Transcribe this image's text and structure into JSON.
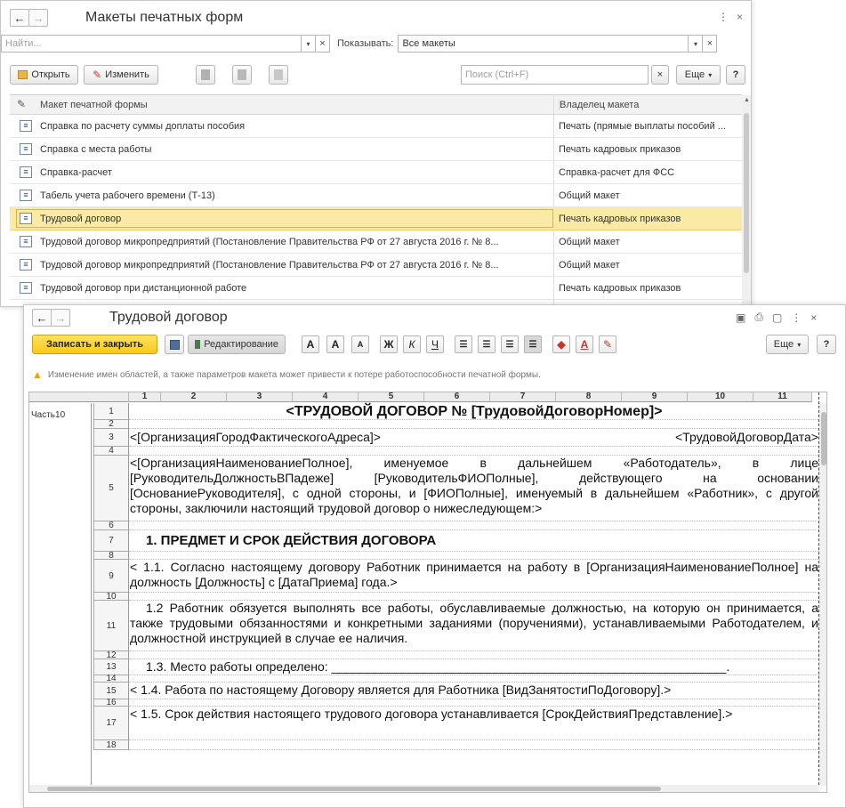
{
  "list": {
    "title": "Макеты печатных форм",
    "find_placeholder": "Найти...",
    "show_label": "Показывать:",
    "show_value": "Все макеты",
    "open_label": "Открыть",
    "edit_label": "Изменить",
    "search_placeholder": "Поиск (Ctrl+F)",
    "more_label": "Еще",
    "help_label": "?",
    "col1": "Макет печатной формы",
    "col2": "Владелец макета",
    "rows": [
      {
        "name": "Справка по расчету суммы доплаты пособия",
        "owner": "Печать (прямые выплаты пособий ..."
      },
      {
        "name": "Справка с места работы",
        "owner": "Печать кадровых приказов"
      },
      {
        "name": "Справка-расчет",
        "owner": "Справка-расчет для ФСС"
      },
      {
        "name": "Табель учета рабочего времени (Т-13)",
        "owner": "Общий макет"
      },
      {
        "name": "Трудовой договор",
        "owner": "Печать кадровых приказов",
        "selected": true
      },
      {
        "name": "Трудовой договор микропредприятий (Постановление Правительства РФ от 27 августа 2016 г. № 8...",
        "owner": "Общий макет"
      },
      {
        "name": "Трудовой договор микропредприятий (Постановление Правительства РФ от 27 августа 2016 г. № 8...",
        "owner": "Общий макет"
      },
      {
        "name": "Трудовой договор при дистанционной работе",
        "owner": "Печать кадровых приказов"
      }
    ]
  },
  "editor": {
    "title": "Трудовой договор",
    "save_close": "Записать и закрыть",
    "editing": "Редактирование",
    "more_label": "Еще",
    "help_label": "?",
    "warning": "Изменение имен областей, а также параметров макета может привести к потере работоспособности печатной формы.",
    "area_name": "Часть10",
    "columns": [
      "1",
      "2",
      "3",
      "4",
      "5",
      "6",
      "7",
      "8",
      "9",
      "10",
      "11"
    ],
    "fmt": {
      "a_big": "A",
      "a_up": "A",
      "a_down": "A",
      "bold": "Ж",
      "italic": "К",
      "underline": "Ч",
      "fill_a": "A"
    },
    "rows": [
      {
        "n": "1",
        "text": "<ТРУДОВОЙ ДОГОВОР № [ТрудовойДоговорНомер]>"
      },
      {
        "n": "2",
        "text": ""
      },
      {
        "n": "3",
        "left": "<[ОрганизацияГородФактическогоАдреса]>",
        "right": "<ТрудовойДоговорДата>"
      },
      {
        "n": "4",
        "text": ""
      },
      {
        "n": "5",
        "text": "<[ОрганизацияНаименованиеПолное], именуемое в дальнейшем «Работодатель», в лице [РуководительДолжностьВПадеже] [РуководительФИОПолные], действующего на основании [ОснованиеРуководителя], с одной стороны, и [ФИОПолные], именуемый в дальнейшем «Работник», с другой стороны, заключили настоящий трудовой договор о нижеследующем:>"
      },
      {
        "n": "6",
        "text": ""
      },
      {
        "n": "7",
        "text": "1. ПРЕДМЕТ И СРОК ДЕЙСТВИЯ ДОГОВОРА"
      },
      {
        "n": "8",
        "text": ""
      },
      {
        "n": "9",
        "text": "<          1.1. Согласно настоящему договору Работник принимается на работу в [ОрганизацияНаименованиеПолное] на должность [Должность] с [ДатаПриема] года.>"
      },
      {
        "n": "10",
        "text": ""
      },
      {
        "n": "11",
        "text": "1.2 Работник обязуется выполнять все работы, обуславливаемые должностью, на которую он принимается, а также трудовыми обязанностями и конкретными заданиями (поручениями), устанавливаемыми Работодателем, и должностной инструкцией в случае ее наличия."
      },
      {
        "n": "12",
        "text": ""
      },
      {
        "n": "13",
        "text": "1.3. Место работы определено: _________________________________________________________."
      },
      {
        "n": "14",
        "text": ""
      },
      {
        "n": "15",
        "text": "<   1.4. Работа по настоящему Договору является для Работника [ВидЗанятостиПоДоговору].>"
      },
      {
        "n": "16",
        "text": ""
      },
      {
        "n": "17",
        "text": "<             1.5. Срок действия настоящего трудового договора устанавливается [СрокДействияПредставление].>"
      },
      {
        "n": "18",
        "text": ""
      }
    ]
  }
}
